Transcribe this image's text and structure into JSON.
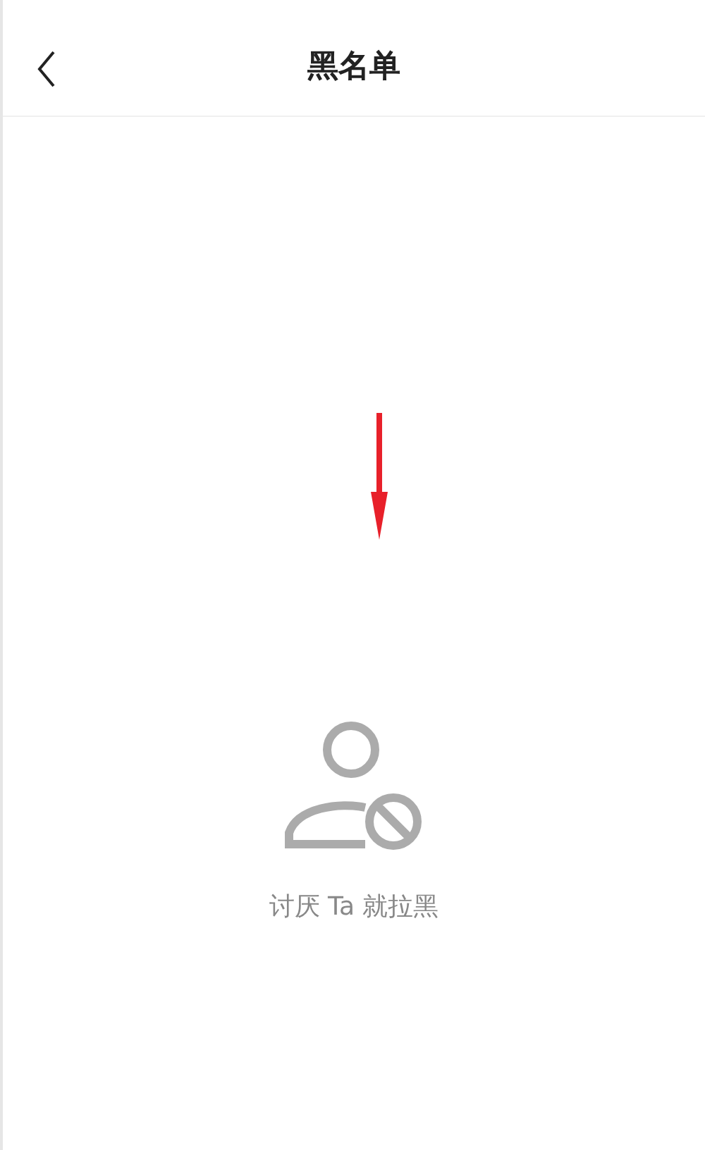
{
  "header": {
    "title": "黑名单"
  },
  "empty_state": {
    "message": "讨厌 Ta 就拉黑"
  }
}
